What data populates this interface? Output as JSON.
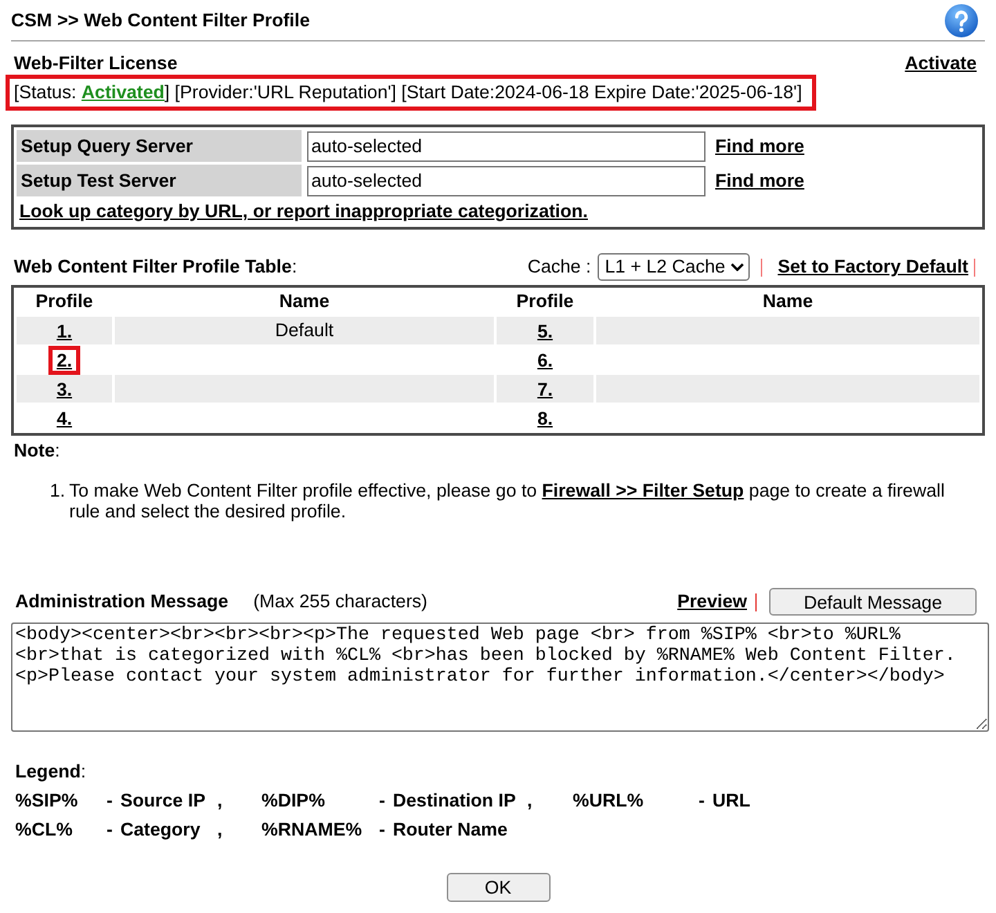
{
  "header": {
    "title": "CSM >> Web Content Filter Profile"
  },
  "license": {
    "heading": "Web-Filter License",
    "action_link": "Activate",
    "status_before": "[Status:",
    "status_link": "Activated",
    "status_after": "] [Provider:'URL Reputation'] [Start Date:2024-06-18 Expire Date:'2025-06-18']",
    "highlighted": true
  },
  "servers": [
    {
      "label": "Setup Query Server",
      "value": "auto-selected",
      "link": "Find more"
    },
    {
      "label": "Setup Test Server",
      "value": "auto-selected",
      "link": "Find more"
    }
  ],
  "lookup_link": "Look up category by URL, or report inappropriate categorization.",
  "profile_table": {
    "title": "**Web Content Filter Profile Table**:",
    "cache_label": "Cache :",
    "cache_value": "L1 + L2 Cache",
    "factory_link": "Set to Factory Default",
    "columns": [
      "Profile",
      "Name",
      "Profile",
      "Name"
    ],
    "profiles": [
      {
        "number": "1.",
        "name": "Default",
        "highlighted": false
      },
      {
        "number": "2.",
        "highlighted": true
      },
      {
        "number": "3.",
        "highlighted": false
      },
      {
        "number": "4.",
        "highlighted": false
      },
      {
        "number": "5.",
        "highlighted": false
      },
      {
        "number": "6.",
        "highlighted": false
      },
      {
        "number": "7.",
        "highlighted": false
      },
      {
        "number": "8.",
        "highlighted": false
      }
    ]
  },
  "note": {
    "heading": "**Note**:",
    "items": [
      {
        "number": "1.",
        "before": "To make Web Content Filter profile effective, please go to",
        "link": "Firewall >> Filter Setup",
        "after": "page to create a firewall rule and select the desired profile."
      }
    ]
  },
  "admin_message": {
    "heading": "Administration Message",
    "hint": "(Max 255 characters)",
    "preview_link": "Preview",
    "default_button": "Default Message",
    "message": "<body><center><br><br><br><p>The requested Web page <br> from %SIP% <br>to %URL% <br>that is categorized with %CL% <br>has been blocked by %RNAME% Web Content Filter. <p>Please contact your system administrator for further information.</center></body>"
  },
  "legend": {
    "heading": "**Legend**:",
    "rows": [
      [
        {
          "code": "%SIP%",
          "dash": "-",
          "description": "Source IP",
          "comma": ","
        },
        {
          "code": "%DIP%",
          "dash": "-",
          "description": "Destination IP",
          "comma": ","
        },
        {
          "code": "%URL%",
          "dash": "-",
          "description": "URL"
        }
      ],
      [
        {
          "code": "%CL%",
          "dash": "-",
          "description": "Category",
          "comma": ","
        },
        {
          "code": "%RNAME%",
          "dash": "-",
          "description": "Router Name"
        }
      ]
    ]
  },
  "ok_button": "OK"
}
